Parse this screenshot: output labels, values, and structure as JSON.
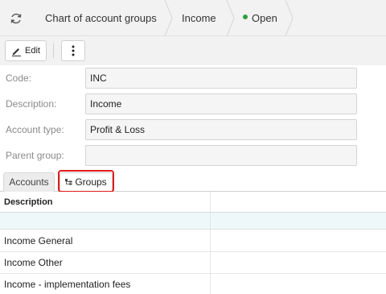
{
  "breadcrumb": {
    "root": "Chart of account groups",
    "current": "Income",
    "status": "Open",
    "status_color": "#2e9e3e"
  },
  "toolbar": {
    "edit_label": "Edit",
    "more_icon": "vertical-ellipsis-icon",
    "edit_icon": "pencil-icon"
  },
  "form": {
    "code": {
      "label": "Code:",
      "value": "INC"
    },
    "description": {
      "label": "Description:",
      "value": "Income"
    },
    "account_type": {
      "label": "Account type:",
      "value": "Profit & Loss"
    },
    "parent_group": {
      "label": "Parent group:",
      "value": ""
    }
  },
  "tabs": [
    {
      "label": "Accounts",
      "active": false
    },
    {
      "label": "Groups",
      "active": true,
      "icon": "tree-icon"
    }
  ],
  "highlight_color": "#e01b1b",
  "grid": {
    "columns": [
      "Description",
      ""
    ],
    "rows": [
      {
        "description": "Income General"
      },
      {
        "description": "Income Other"
      },
      {
        "description": "Income - implementation fees"
      }
    ]
  }
}
